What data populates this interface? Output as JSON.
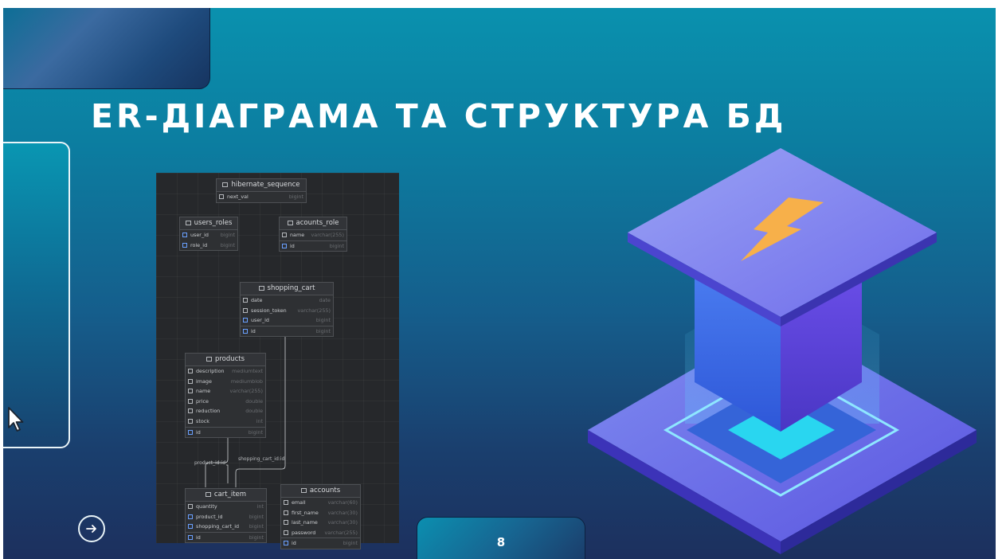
{
  "slide": {
    "title": "ER-ДІАГРАМА ТА СТРУКТУРА БД",
    "page_number": "8",
    "next_icon": "arrow-right-circle-icon",
    "cursor_icon": "mouse-pointer-icon",
    "illustration_icon": "lightning-bolt-icon"
  },
  "erd": {
    "tables": [
      {
        "name": "hibernate_sequence",
        "columns": [
          {
            "name": "next_val",
            "type": "bigint"
          }
        ]
      },
      {
        "name": "users_roles",
        "columns": [
          {
            "name": "user_id",
            "type": "bigint"
          },
          {
            "name": "role_id",
            "type": "bigint"
          }
        ]
      },
      {
        "name": "acounts_role",
        "columns": [
          {
            "name": "name",
            "type": "varchar(255)"
          },
          {
            "name": "id",
            "type": "bigint"
          }
        ]
      },
      {
        "name": "shopping_cart",
        "columns": [
          {
            "name": "date",
            "type": "date"
          },
          {
            "name": "session_token",
            "type": "varchar(255)"
          },
          {
            "name": "user_id",
            "type": "bigint"
          },
          {
            "name": "id",
            "type": "bigint"
          }
        ]
      },
      {
        "name": "products",
        "columns": [
          {
            "name": "description",
            "type": "mediumtext"
          },
          {
            "name": "image",
            "type": "mediumblob"
          },
          {
            "name": "name",
            "type": "varchar(255)"
          },
          {
            "name": "price",
            "type": "double"
          },
          {
            "name": "reduction",
            "type": "double"
          },
          {
            "name": "stock",
            "type": "int"
          },
          {
            "name": "id",
            "type": "bigint"
          }
        ]
      },
      {
        "name": "cart_item",
        "columns": [
          {
            "name": "quantity",
            "type": "int"
          },
          {
            "name": "product_id",
            "type": "bigint"
          },
          {
            "name": "shopping_cart_id",
            "type": "bigint"
          },
          {
            "name": "id",
            "type": "bigint"
          }
        ]
      },
      {
        "name": "accounts",
        "columns": [
          {
            "name": "email",
            "type": "varchar(60)"
          },
          {
            "name": "first_name",
            "type": "varchar(30)"
          },
          {
            "name": "last_name",
            "type": "varchar(30)"
          },
          {
            "name": "password",
            "type": "varchar(255)"
          },
          {
            "name": "id",
            "type": "bigint"
          }
        ]
      }
    ],
    "relations": [
      {
        "label": "product_id:id"
      },
      {
        "label": "shopping_cart_id:id"
      }
    ]
  }
}
